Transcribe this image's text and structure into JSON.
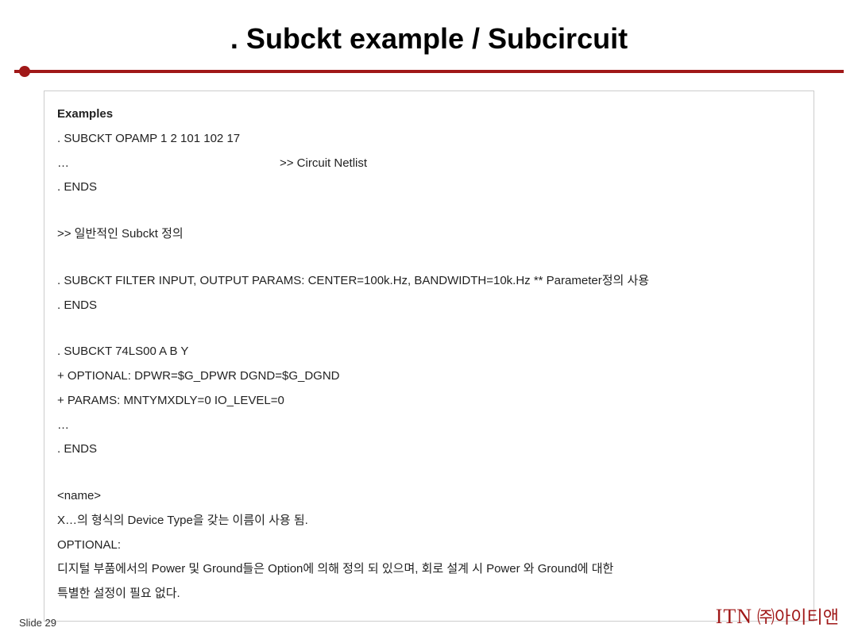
{
  "title": ". Subckt example / Subcircuit",
  "box": {
    "examples_label": "Examples",
    "line1": ". SUBCKT OPAMP 1 2 101 102 17",
    "netlist_left": "…",
    "netlist_right": ">> Circuit Netlist",
    "line3": ". ENDS",
    "line4": ">> 일반적인 Subckt 정의",
    "line5": ". SUBCKT FILTER INPUT, OUTPUT PARAMS: CENTER=100k.Hz, BANDWIDTH=10k.Hz  ** Parameter정의 사용",
    "line6": ". ENDS",
    "line7": ". SUBCKT 74LS00 A B Y",
    "line8": "+ OPTIONAL: DPWR=$G_DPWR DGND=$G_DGND",
    "line9": "+ PARAMS: MNTYMXDLY=0 IO_LEVEL=0",
    "line10": "…",
    "line11": ". ENDS",
    "line12": "<name>",
    "line13": "X…의 형식의 Device Type을 갖는 이름이 사용 됨.",
    "line14": "OPTIONAL:",
    "line15": "디지털 부품에서의 Power 및 Ground들은 Option에 의해 정의 되 있으며, 회로 설계 시 Power 와 Ground에 대한",
    "line16": "특별한 설정이 필요 없다."
  },
  "footer": {
    "slide": "Slide 29",
    "brand_itn": "ITN",
    "brand_ko": "㈜아이티앤"
  }
}
